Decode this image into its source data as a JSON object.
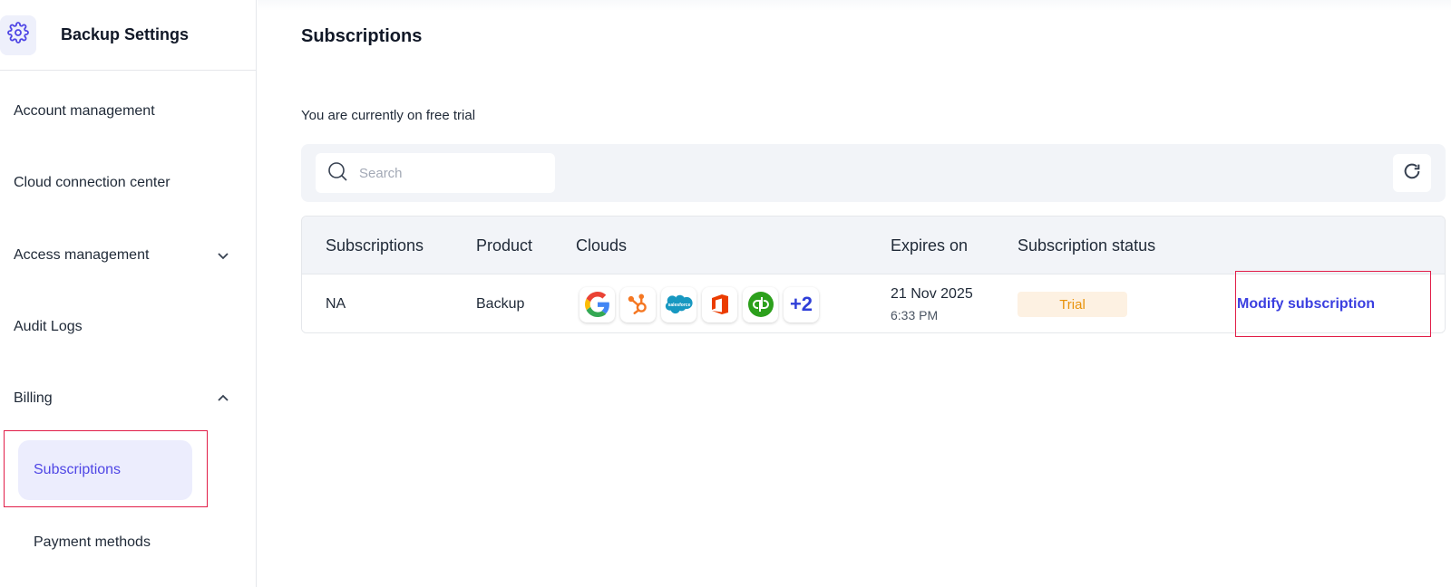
{
  "sidebar": {
    "title": "Backup Settings",
    "header_icon": "gear-icon",
    "items": [
      {
        "label": "Account management"
      },
      {
        "label": "Cloud connection center"
      },
      {
        "label": "Access management",
        "chevron": "down"
      },
      {
        "label": "Audit Logs"
      },
      {
        "label": "Billing",
        "chevron": "up"
      }
    ],
    "sub_items": [
      {
        "label": "Subscriptions",
        "active": true
      },
      {
        "label": "Payment methods",
        "active": false
      }
    ]
  },
  "main": {
    "title": "Subscriptions",
    "trial_note": "You are currently on free trial",
    "search": {
      "placeholder": "Search",
      "value": ""
    },
    "refresh_icon": "refresh-icon",
    "table": {
      "headers": [
        "Subscriptions",
        "Product",
        "Clouds",
        "Expires on",
        "Subscription status"
      ],
      "rows": [
        {
          "subscription": "NA",
          "product": "Backup",
          "clouds": [
            "google-icon",
            "hubspot-icon",
            "salesforce-icon",
            "office-icon",
            "quickbooks-icon"
          ],
          "clouds_more": "+2",
          "expires_date": "21 Nov 2025",
          "expires_time": "6:33 PM",
          "status": "Trial",
          "action": "Modify subscription"
        }
      ]
    }
  },
  "colors": {
    "accent": "#4f46e5",
    "link": "#3b3fe0",
    "badge_bg": "#fdf1e2",
    "badge_text": "#e8920b",
    "highlight": "#e11d48"
  }
}
